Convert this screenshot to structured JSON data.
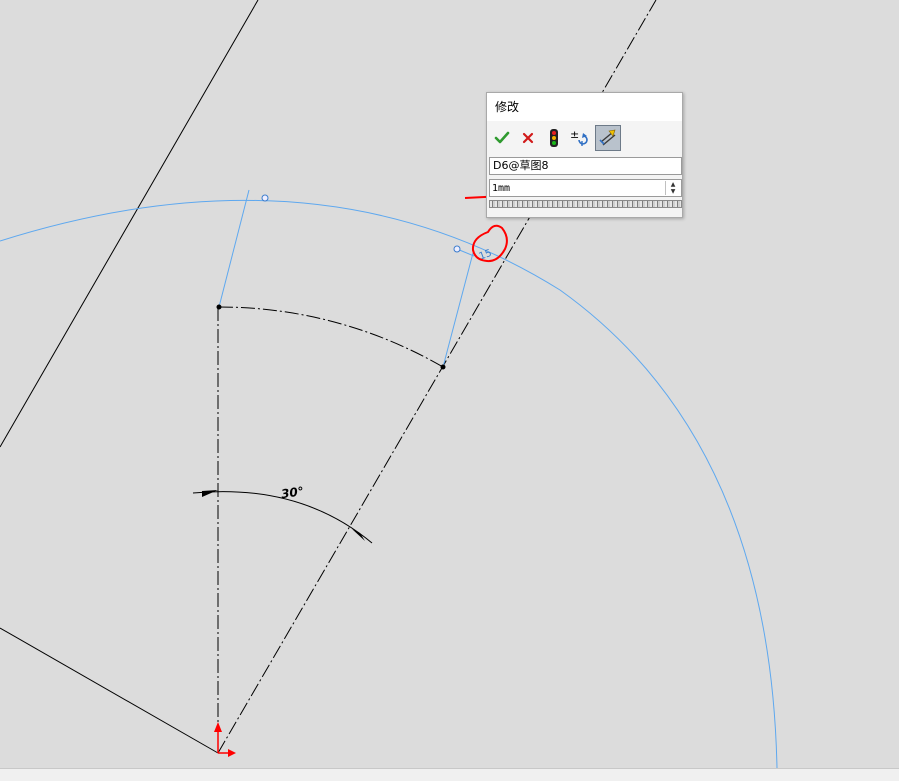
{
  "dialog": {
    "title": "修改",
    "toolbar": [
      {
        "name": "ok",
        "icon": "check-icon"
      },
      {
        "name": "cancel",
        "icon": "x-icon"
      },
      {
        "name": "rebuild",
        "icon": "traffic-light-icon"
      },
      {
        "name": "reverse-sense",
        "icon": "plus-minus-reverse-icon"
      },
      {
        "name": "mark-for-drawing",
        "icon": "mark-dimension-icon",
        "active": true
      }
    ],
    "dimension_name": "D6@草图8",
    "value": "1mm"
  },
  "sketch": {
    "angle_label": "30°",
    "dimension_tag": "15",
    "colors": {
      "sketch_line": "#000000",
      "construction_arc": "#5ea8ef",
      "annotation": "#ff0000",
      "origin": "#ff0000",
      "background": "#dcdcdc"
    }
  }
}
